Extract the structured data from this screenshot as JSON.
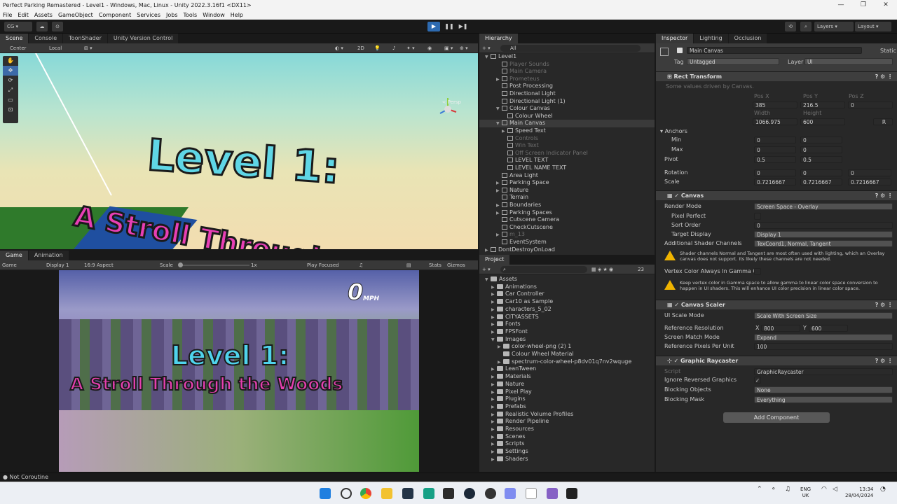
{
  "window": {
    "title": "Perfect Parking Remastered - Level1 - Windows, Mac, Linux - Unity 2022.3.16f1 <DX11>",
    "controls": [
      "—",
      "❐",
      "✕"
    ]
  },
  "menu": [
    "File",
    "Edit",
    "Assets",
    "GameObject",
    "Component",
    "Services",
    "Jobs",
    "Tools",
    "Window",
    "Help"
  ],
  "toolbar": {
    "account": "CG",
    "layers": "Layers",
    "layout": "Layout",
    "play": "▶",
    "pause": "❚❚",
    "step": "▶❚"
  },
  "scene_panel": {
    "tabs": [
      "Scene",
      "Console",
      "ToonShader",
      "Unity Version Control"
    ],
    "pivot": "Center",
    "space": "Local",
    "mode_2d": "2D",
    "persp": "< Persp",
    "title_line1": "Level 1:",
    "title_line2": "A Stroll Through the Wo"
  },
  "game_panel": {
    "tabs": [
      "Game",
      "Animation"
    ],
    "mode": "Game",
    "display": "Display 1",
    "aspect": "16:9 Aspect",
    "scale_label": "Scale",
    "scale_value": "1x",
    "play_focused": "Play Focused",
    "stats": "Stats",
    "gizmos": "Gizmos",
    "speed": "0",
    "speed_unit": "MPH",
    "title_line1": "Level 1:",
    "title_line2": "A Stroll Through the Woods"
  },
  "hierarchy": {
    "tab": "Hierarchy",
    "search": "All",
    "items": [
      {
        "label": "Level1",
        "indent": 0,
        "dim": false,
        "sel": false,
        "arrow": "▼"
      },
      {
        "label": "Player Sounds",
        "indent": 2,
        "dim": true,
        "sel": false,
        "arrow": ""
      },
      {
        "label": "Main Camera",
        "indent": 2,
        "dim": true,
        "sel": false,
        "arrow": ""
      },
      {
        "label": "Prometeus",
        "indent": 2,
        "dim": true,
        "sel": false,
        "arrow": "▶"
      },
      {
        "label": "Post Processing",
        "indent": 2,
        "dim": false,
        "sel": false,
        "arrow": ""
      },
      {
        "label": "Directional Light",
        "indent": 2,
        "dim": false,
        "sel": false,
        "arrow": ""
      },
      {
        "label": "Directional Light (1)",
        "indent": 2,
        "dim": false,
        "sel": false,
        "arrow": ""
      },
      {
        "label": "Colour Canvas",
        "indent": 2,
        "dim": false,
        "sel": false,
        "arrow": "▼"
      },
      {
        "label": "Colour Wheel",
        "indent": 3,
        "dim": false,
        "sel": false,
        "arrow": ""
      },
      {
        "label": "Main Canvas",
        "indent": 2,
        "dim": false,
        "sel": true,
        "arrow": "▼"
      },
      {
        "label": "Speed Text",
        "indent": 3,
        "dim": false,
        "sel": false,
        "arrow": "▶"
      },
      {
        "label": "Controls",
        "indent": 3,
        "dim": true,
        "sel": false,
        "arrow": ""
      },
      {
        "label": "Win Text",
        "indent": 3,
        "dim": true,
        "sel": false,
        "arrow": ""
      },
      {
        "label": "Off Screen Indicator Panel",
        "indent": 3,
        "dim": true,
        "sel": false,
        "arrow": ""
      },
      {
        "label": "LEVEL TEXT",
        "indent": 3,
        "dim": false,
        "sel": false,
        "arrow": ""
      },
      {
        "label": "LEVEL NAME TEXT",
        "indent": 3,
        "dim": false,
        "sel": false,
        "arrow": ""
      },
      {
        "label": "Area Light",
        "indent": 2,
        "dim": false,
        "sel": false,
        "arrow": ""
      },
      {
        "label": "Parking Space",
        "indent": 2,
        "dim": false,
        "sel": false,
        "arrow": "▶"
      },
      {
        "label": "Nature",
        "indent": 2,
        "dim": false,
        "sel": false,
        "arrow": "▶"
      },
      {
        "label": "Terrain",
        "indent": 2,
        "dim": false,
        "sel": false,
        "arrow": ""
      },
      {
        "label": "Boundaries",
        "indent": 2,
        "dim": false,
        "sel": false,
        "arrow": "▶"
      },
      {
        "label": "Parking Spaces",
        "indent": 2,
        "dim": false,
        "sel": false,
        "arrow": "▶"
      },
      {
        "label": "Cutscene Camera",
        "indent": 2,
        "dim": false,
        "sel": false,
        "arrow": ""
      },
      {
        "label": "CheckCutscene",
        "indent": 2,
        "dim": false,
        "sel": false,
        "arrow": ""
      },
      {
        "label": "m_13",
        "indent": 2,
        "dim": true,
        "sel": false,
        "arrow": "▶"
      },
      {
        "label": "EventSystem",
        "indent": 2,
        "dim": false,
        "sel": false,
        "arrow": ""
      },
      {
        "label": "DontDestroyOnLoad",
        "indent": 0,
        "dim": false,
        "sel": false,
        "arrow": "▶"
      }
    ]
  },
  "project": {
    "tab": "Project",
    "count": "23",
    "items": [
      {
        "label": "Assets",
        "indent": 0,
        "arrow": "▼"
      },
      {
        "label": "Animations",
        "indent": 1,
        "arrow": "▶"
      },
      {
        "label": "Car Controller",
        "indent": 1,
        "arrow": "▶"
      },
      {
        "label": "Car10 as Sample",
        "indent": 1,
        "arrow": "▶"
      },
      {
        "label": "characters_5_02",
        "indent": 1,
        "arrow": "▶"
      },
      {
        "label": "CITYASSETS",
        "indent": 1,
        "arrow": "▶"
      },
      {
        "label": "Fonts",
        "indent": 1,
        "arrow": "▶"
      },
      {
        "label": "FPSFont",
        "indent": 1,
        "arrow": "▶"
      },
      {
        "label": "Images",
        "indent": 1,
        "arrow": "▼"
      },
      {
        "label": "color-wheel-png (2) 1",
        "indent": 2,
        "arrow": "▶"
      },
      {
        "label": "Colour Wheel Material",
        "indent": 2,
        "arrow": ""
      },
      {
        "label": "spectrum-color-wheel-p8dv01q7nv2wquge",
        "indent": 2,
        "arrow": "▶"
      },
      {
        "label": "LeanTween",
        "indent": 1,
        "arrow": "▶"
      },
      {
        "label": "Materials",
        "indent": 1,
        "arrow": "▶"
      },
      {
        "label": "Nature",
        "indent": 1,
        "arrow": "▶"
      },
      {
        "label": "Pixel Play",
        "indent": 1,
        "arrow": "▶"
      },
      {
        "label": "Plugins",
        "indent": 1,
        "arrow": "▶"
      },
      {
        "label": "Prefabs",
        "indent": 1,
        "arrow": "▶"
      },
      {
        "label": "Realistic Volume Profiles",
        "indent": 1,
        "arrow": "▶"
      },
      {
        "label": "Render Pipeline",
        "indent": 1,
        "arrow": "▶"
      },
      {
        "label": "Resources",
        "indent": 1,
        "arrow": "▶"
      },
      {
        "label": "Scenes",
        "indent": 1,
        "arrow": "▶"
      },
      {
        "label": "Scripts",
        "indent": 1,
        "arrow": "▶"
      },
      {
        "label": "Settings",
        "indent": 1,
        "arrow": "▶"
      },
      {
        "label": "Shaders",
        "indent": 1,
        "arrow": "▶"
      }
    ]
  },
  "inspector": {
    "tabs": [
      "Inspector",
      "Lighting",
      "Occlusion"
    ],
    "object_name": "Main Canvas",
    "static": "Static",
    "tag_label": "Tag",
    "tag_value": "Untagged",
    "layer_label": "Layer",
    "layer_value": "UI",
    "rect": {
      "title": "Rect Transform",
      "note": "Some values driven by Canvas.",
      "posx_label": "Pos X",
      "posx": "385",
      "posy_label": "Pos Y",
      "posy": "216.5",
      "posz_label": "Pos Z",
      "posz": "0",
      "width_label": "Width",
      "width": "1066.975",
      "height_label": "Height",
      "height": "600",
      "anchors": "Anchors",
      "min": "Min",
      "min_x": "0",
      "min_y": "0",
      "max": "Max",
      "max_x": "0",
      "max_y": "0",
      "pivot": "Pivot",
      "pivot_x": "0.5",
      "pivot_y": "0.5",
      "rotation": "Rotation",
      "rot_x": "0",
      "rot_y": "0",
      "rot_z": "0",
      "scale": "Scale",
      "scale_x": "0.7216667",
      "scale_y": "0.7216667",
      "scale_z": "0.7216667",
      "x": "X",
      "y": "Y",
      "z": "Z",
      "r": "R"
    },
    "canvas": {
      "title": "Canvas",
      "render_mode_label": "Render Mode",
      "render_mode": "Screen Space - Overlay",
      "pixel_perfect": "Pixel Perfect",
      "sort_order_label": "Sort Order",
      "sort_order": "0",
      "target_display_label": "Target Display",
      "target_display": "Display 1",
      "shader_channels_label": "Additional Shader Channels",
      "shader_channels": "TexCoord1, Normal, Tangent",
      "warn1": "Shader channels Normal and Tangent are most often used with lighting, which an Overlay canvas does not support. Its likely these channels are not needed.",
      "vertex_gamma": "Vertex Color Always In Gamma Co",
      "warn2": "Keep vertex color in Gamma space to allow gamma to linear color space conversion to happen in UI shaders. This will enhance UI color precision in linear color space."
    },
    "scaler": {
      "title": "Canvas Scaler",
      "ui_scale_label": "UI Scale Mode",
      "ui_scale": "Scale With Screen Size",
      "ref_res_label": "Reference Resolution",
      "ref_x": "800",
      "ref_y": "600",
      "match_label": "Screen Match Mode",
      "match": "Expand",
      "ppu_label": "Reference Pixels Per Unit",
      "ppu": "100"
    },
    "raycaster": {
      "title": "Graphic Raycaster",
      "script_label": "Script",
      "script": "GraphicRaycaster",
      "ignore_label": "Ignore Reversed Graphics",
      "ignore": "✓",
      "blocking_objects_label": "Blocking Objects",
      "blocking_objects": "None",
      "blocking_mask_label": "Blocking Mask",
      "blocking_mask": "Everything"
    },
    "add_component": "Add Component"
  },
  "status": "Not Coroutine",
  "taskbar": {
    "lang1": "ENG",
    "lang2": "UK",
    "time": "13:34",
    "date": "28/04/2024"
  }
}
